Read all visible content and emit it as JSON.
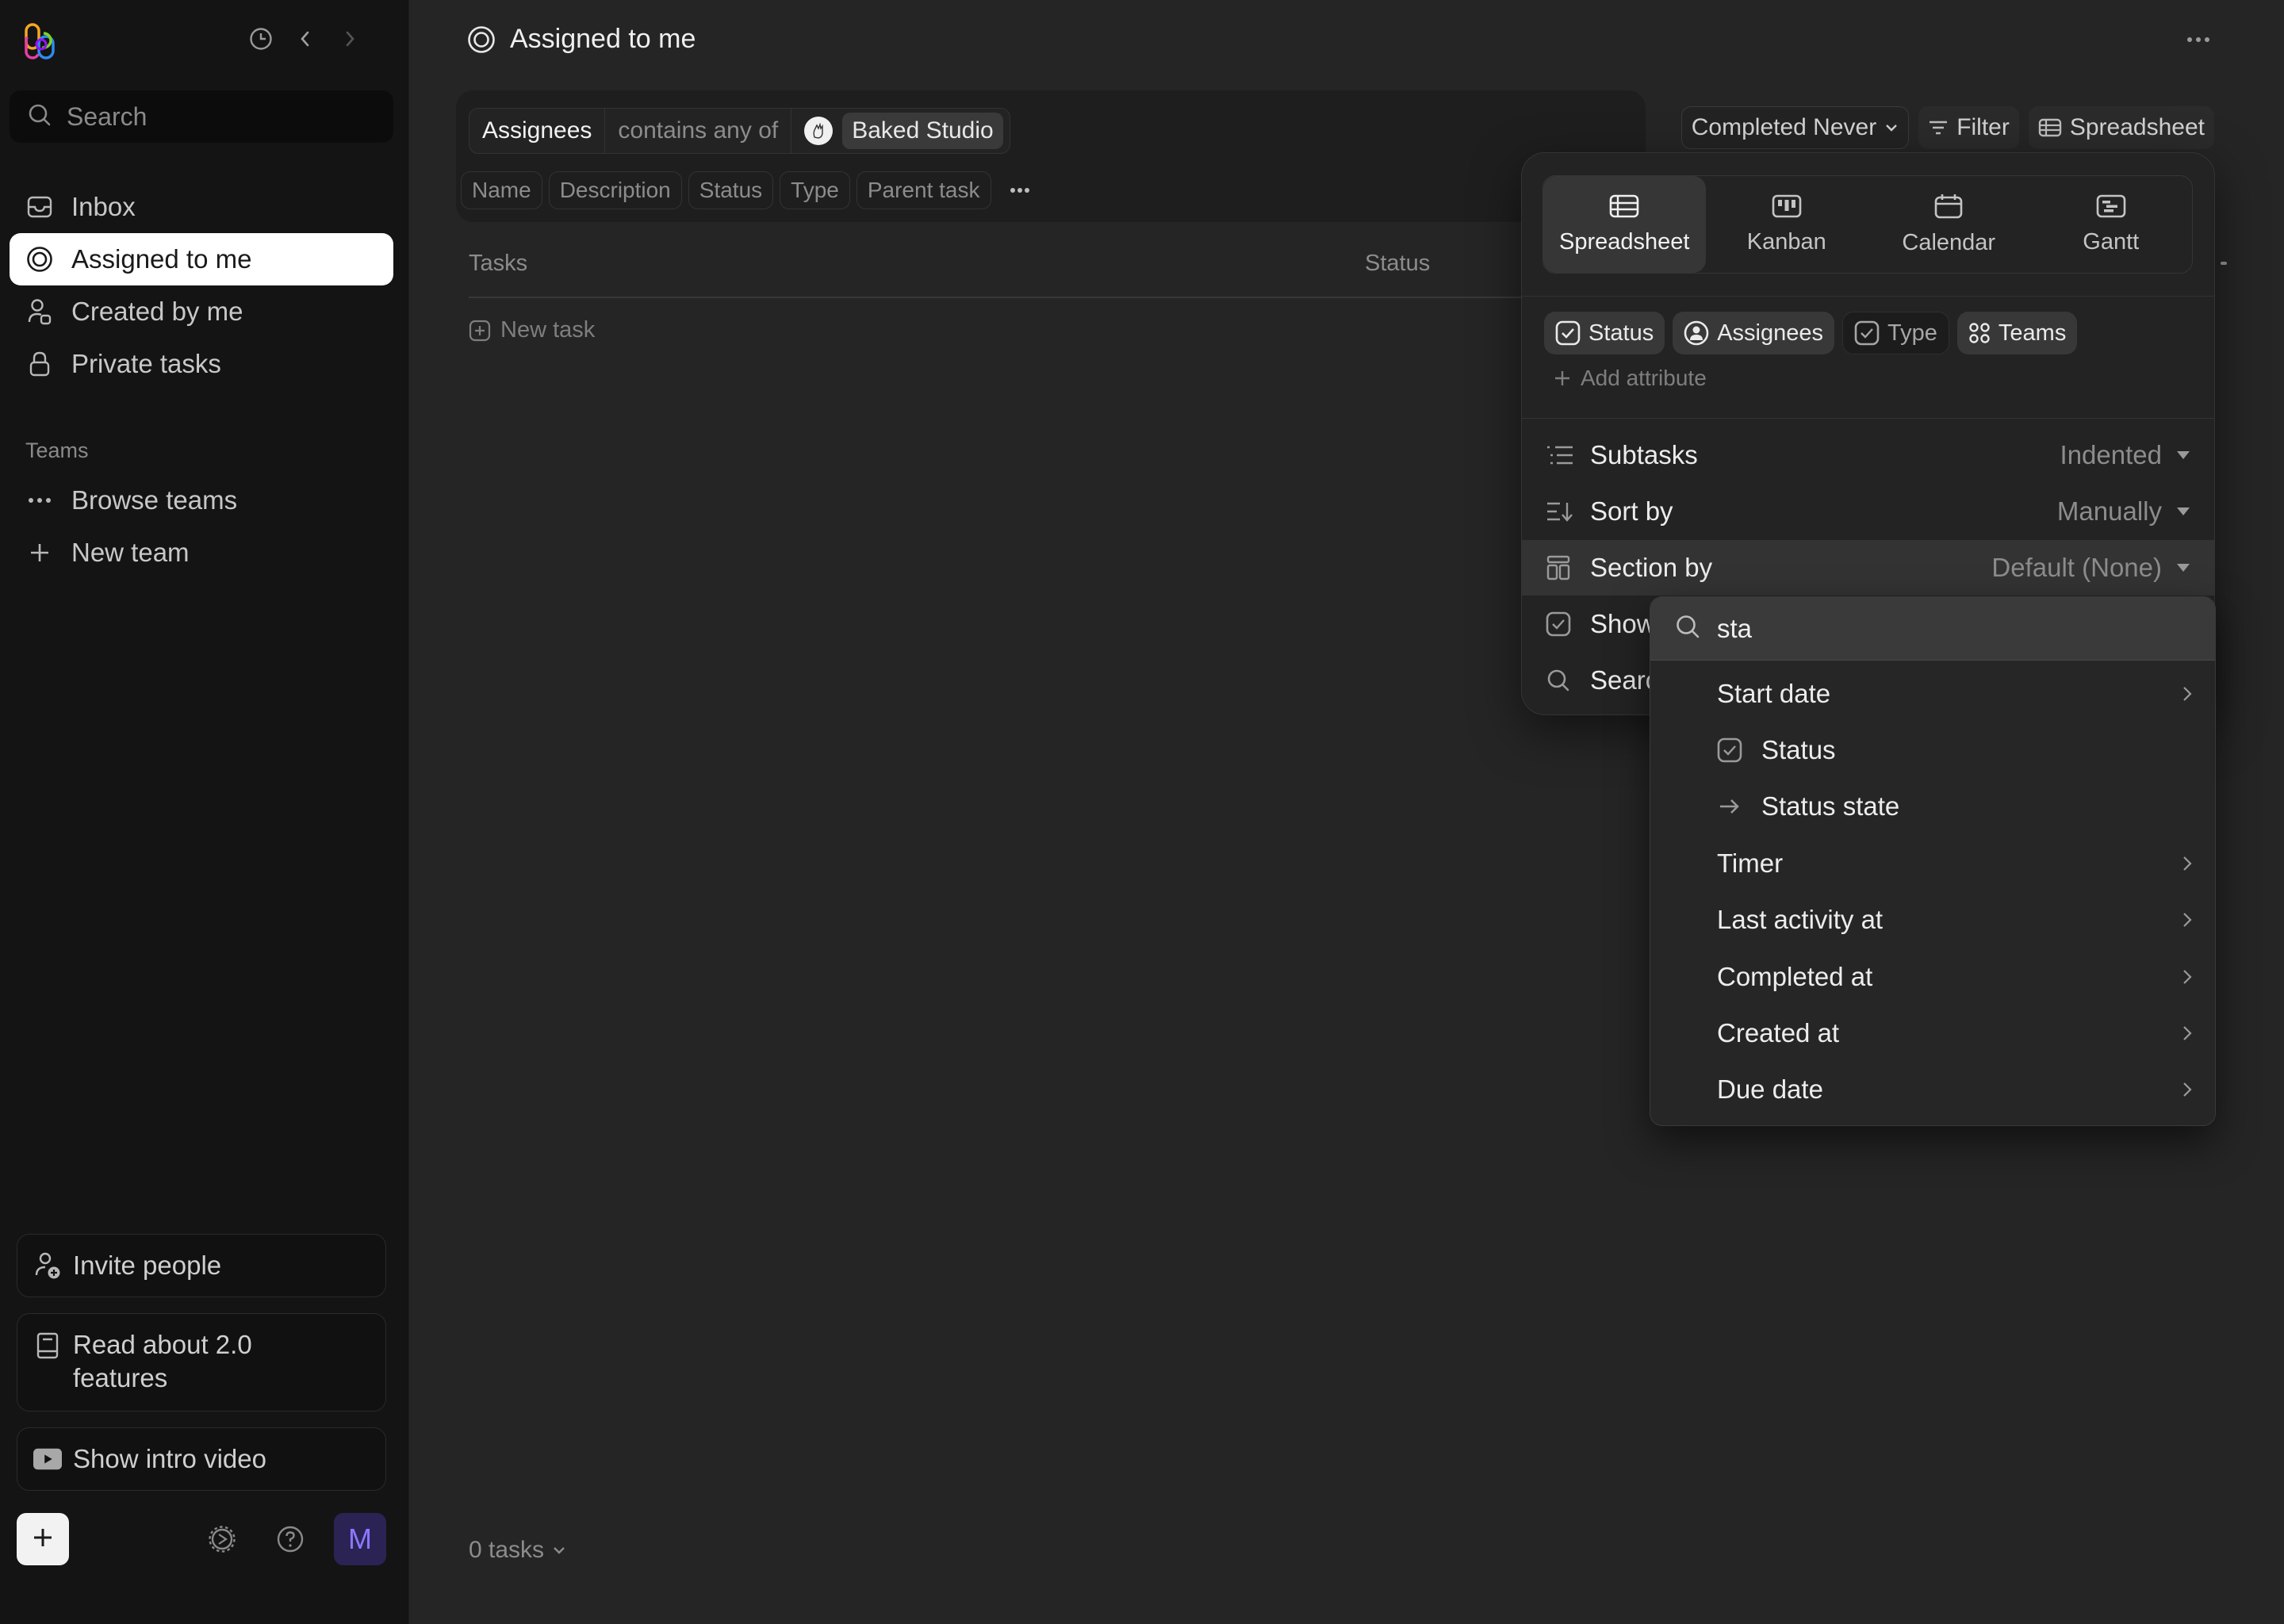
{
  "sidebar": {
    "icons": {
      "logo": "linked-rings-logo",
      "history": "clock-icon",
      "back": "chevron-left-icon",
      "forward": "chevron-right-icon"
    },
    "search": {
      "placeholder": "Search",
      "value": ""
    },
    "nav": [
      {
        "label": "Inbox",
        "icon": "inbox-icon",
        "active": false
      },
      {
        "label": "Assigned to me",
        "icon": "target-icon",
        "active": true
      },
      {
        "label": "Created by me",
        "icon": "user-icon",
        "active": false
      },
      {
        "label": "Private tasks",
        "icon": "lock-icon",
        "active": false
      }
    ],
    "teams_label": "Teams",
    "teams_nav": [
      {
        "label": "Browse teams",
        "icon": "ellipsis-icon"
      },
      {
        "label": "New team",
        "icon": "plus-icon"
      }
    ],
    "bottom_buttons": [
      {
        "label": "Invite people",
        "icon": "user-plus-icon"
      },
      {
        "label": "Read about 2.0 features",
        "icon": "book-icon"
      },
      {
        "label": "Show intro video",
        "icon": "video-play-icon"
      }
    ],
    "footer": {
      "add": "plus-icon",
      "settings": "gear-icon",
      "help": "help-icon",
      "avatar_initial": "M",
      "avatar_color": "#2b2354"
    }
  },
  "main": {
    "title": "Assigned to me",
    "filter": {
      "attribute": "Assignees",
      "operator": "contains any of",
      "value": "Baked Studio"
    },
    "columns": [
      "Name",
      "Description",
      "Status",
      "Type",
      "Parent task"
    ],
    "toolbar": {
      "completed": "Completed Never",
      "filter": "Filter",
      "view": "Spreadsheet"
    },
    "table": {
      "headers": [
        "Tasks",
        "Status"
      ],
      "new_task": "New task"
    },
    "footer_count": "0 tasks"
  },
  "view_popover": {
    "views": [
      {
        "label": "Spreadsheet",
        "icon": "table-icon",
        "active": true
      },
      {
        "label": "Kanban",
        "icon": "kanban-icon",
        "active": false
      },
      {
        "label": "Calendar",
        "icon": "calendar-icon",
        "active": false
      },
      {
        "label": "Gantt",
        "icon": "gantt-icon",
        "active": false
      }
    ],
    "attributes": [
      {
        "label": "Status",
        "icon": "checkbox-icon",
        "enabled": true
      },
      {
        "label": "Assignees",
        "icon": "user-circle-icon",
        "enabled": true
      },
      {
        "label": "Type",
        "icon": "checkbox-icon",
        "enabled": false
      },
      {
        "label": "Teams",
        "icon": "grid-icon",
        "enabled": true
      }
    ],
    "add_attribute": "Add attribute",
    "options": [
      {
        "label": "Subtasks",
        "value": "Indented",
        "icon": "list-indent-icon"
      },
      {
        "label": "Sort by",
        "value": "Manually",
        "icon": "sort-icon"
      },
      {
        "label": "Section by",
        "value": "Default (None)",
        "icon": "layout-icon"
      },
      {
        "label": "Show",
        "value": "",
        "icon": "checkbox-icon"
      },
      {
        "label": "Search",
        "value": "",
        "icon": "search-icon"
      }
    ]
  },
  "section_dropdown": {
    "search_value": "sta",
    "items": [
      {
        "label": "Start date",
        "icon": "",
        "submenu": true
      },
      {
        "label": "Status",
        "icon": "checkbox-icon",
        "submenu": false
      },
      {
        "label": "Status state",
        "icon": "arrow-right-icon",
        "submenu": false
      },
      {
        "label": "Timer",
        "icon": "",
        "submenu": true
      },
      {
        "label": "Last activity at",
        "icon": "",
        "submenu": true
      },
      {
        "label": "Completed at",
        "icon": "",
        "submenu": true
      },
      {
        "label": "Created at",
        "icon": "",
        "submenu": true
      },
      {
        "label": "Due date",
        "icon": "",
        "submenu": true
      }
    ]
  }
}
